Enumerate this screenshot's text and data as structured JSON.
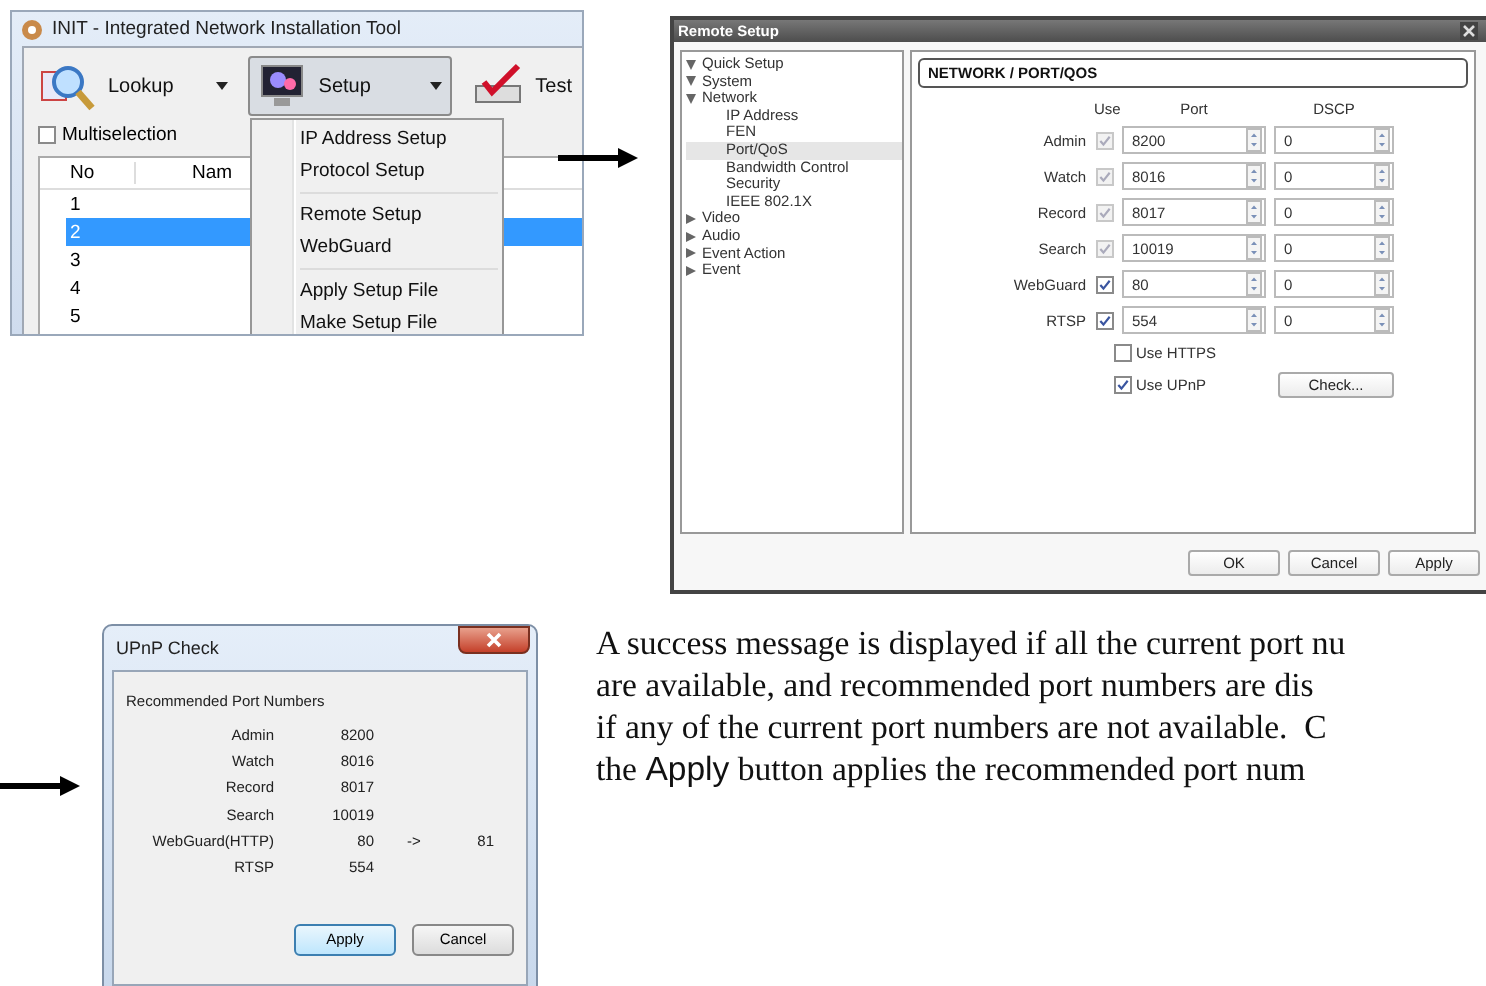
{
  "init_window": {
    "title": "INIT - Integrated Network Installation Tool",
    "toolbar": [
      {
        "label": "Lookup",
        "kind": "lookup",
        "dropdown": true,
        "selected": false
      },
      {
        "label": "Setup",
        "kind": "setup",
        "dropdown": true,
        "selected": true
      },
      {
        "label": "Test",
        "kind": "test",
        "dropdown": false,
        "selected": false
      }
    ],
    "multiselection": {
      "label": "Multiselection",
      "checked": false
    },
    "table": {
      "columns": [
        "No",
        "Nam"
      ],
      "rows": [
        {
          "no": "1",
          "selected": false
        },
        {
          "no": "2",
          "selected": true
        },
        {
          "no": "3",
          "selected": false
        },
        {
          "no": "4",
          "selected": false
        },
        {
          "no": "5",
          "selected": false
        }
      ]
    },
    "menu": {
      "groups": [
        [
          "IP Address Setup",
          "Protocol Setup"
        ],
        [
          "Remote Setup",
          "WebGuard"
        ],
        [
          "Apply Setup File",
          "Make Setup File"
        ]
      ]
    }
  },
  "remote_setup": {
    "title": "Remote Setup",
    "tree": [
      {
        "label": "Quick Setup",
        "expanded": true,
        "selected": false
      },
      {
        "label": "System",
        "expanded": true,
        "selected": false
      },
      {
        "label": "Network",
        "expanded": true,
        "selected": false,
        "children": [
          {
            "label": "IP Address",
            "selected": false
          },
          {
            "label": "FEN",
            "selected": false
          },
          {
            "label": "Port/QoS",
            "selected": true
          },
          {
            "label": "Bandwidth Control",
            "selected": false
          },
          {
            "label": "Security",
            "selected": false
          },
          {
            "label": "IEEE 802.1X",
            "selected": false
          }
        ]
      },
      {
        "label": "Video",
        "expanded": false,
        "selected": false
      },
      {
        "label": "Audio",
        "expanded": false,
        "selected": false
      },
      {
        "label": "Event Action",
        "expanded": false,
        "selected": false
      },
      {
        "label": "Event",
        "expanded": false,
        "selected": false
      }
    ],
    "section_title": "NETWORK / PORT/QOS",
    "columns": [
      "Use",
      "Port",
      "DSCP"
    ],
    "rows": [
      {
        "label": "Admin",
        "use": true,
        "disabled": true,
        "port": "8200",
        "dscp": "0"
      },
      {
        "label": "Watch",
        "use": true,
        "disabled": true,
        "port": "8016",
        "dscp": "0"
      },
      {
        "label": "Record",
        "use": true,
        "disabled": true,
        "port": "8017",
        "dscp": "0"
      },
      {
        "label": "Search",
        "use": true,
        "disabled": true,
        "port": "10019",
        "dscp": "0"
      },
      {
        "label": "WebGuard",
        "use": true,
        "disabled": false,
        "port": "80",
        "dscp": "0"
      },
      {
        "label": "RTSP",
        "use": true,
        "disabled": false,
        "port": "554",
        "dscp": "0"
      }
    ],
    "options": [
      {
        "label": "Use HTTPS",
        "checked": false
      },
      {
        "label": "Use UPnP",
        "checked": true
      }
    ],
    "check_button": "Check...",
    "buttons": [
      "OK",
      "Cancel",
      "Apply"
    ]
  },
  "upnp_check": {
    "title": "UPnP Check",
    "group_title": "Recommended Port Numbers",
    "rows": [
      {
        "name": "Admin",
        "port": "8200"
      },
      {
        "name": "Watch",
        "port": "8016"
      },
      {
        "name": "Record",
        "port": "8017"
      },
      {
        "name": "Search",
        "port": "10019"
      },
      {
        "name": "WebGuard(HTTP)",
        "port": "80",
        "arrow": "->",
        "recommended": "81"
      },
      {
        "name": "RTSP",
        "port": "554"
      }
    ],
    "buttons": [
      {
        "label": "Apply",
        "default": true
      },
      {
        "label": "Cancel",
        "default": false
      }
    ]
  },
  "description": {
    "lines": [
      [
        {
          "text": "A success message is displayed if all the current port nu"
        }
      ],
      [
        {
          "text": "are available, and recommended port numbers are dis"
        }
      ],
      [
        {
          "text": "if any of the current port numbers are not available.  C"
        }
      ],
      [
        {
          "text": "the "
        },
        {
          "text": "Apply",
          "kind": "ui"
        },
        {
          "text": " button applies the recommended port num"
        }
      ]
    ]
  }
}
